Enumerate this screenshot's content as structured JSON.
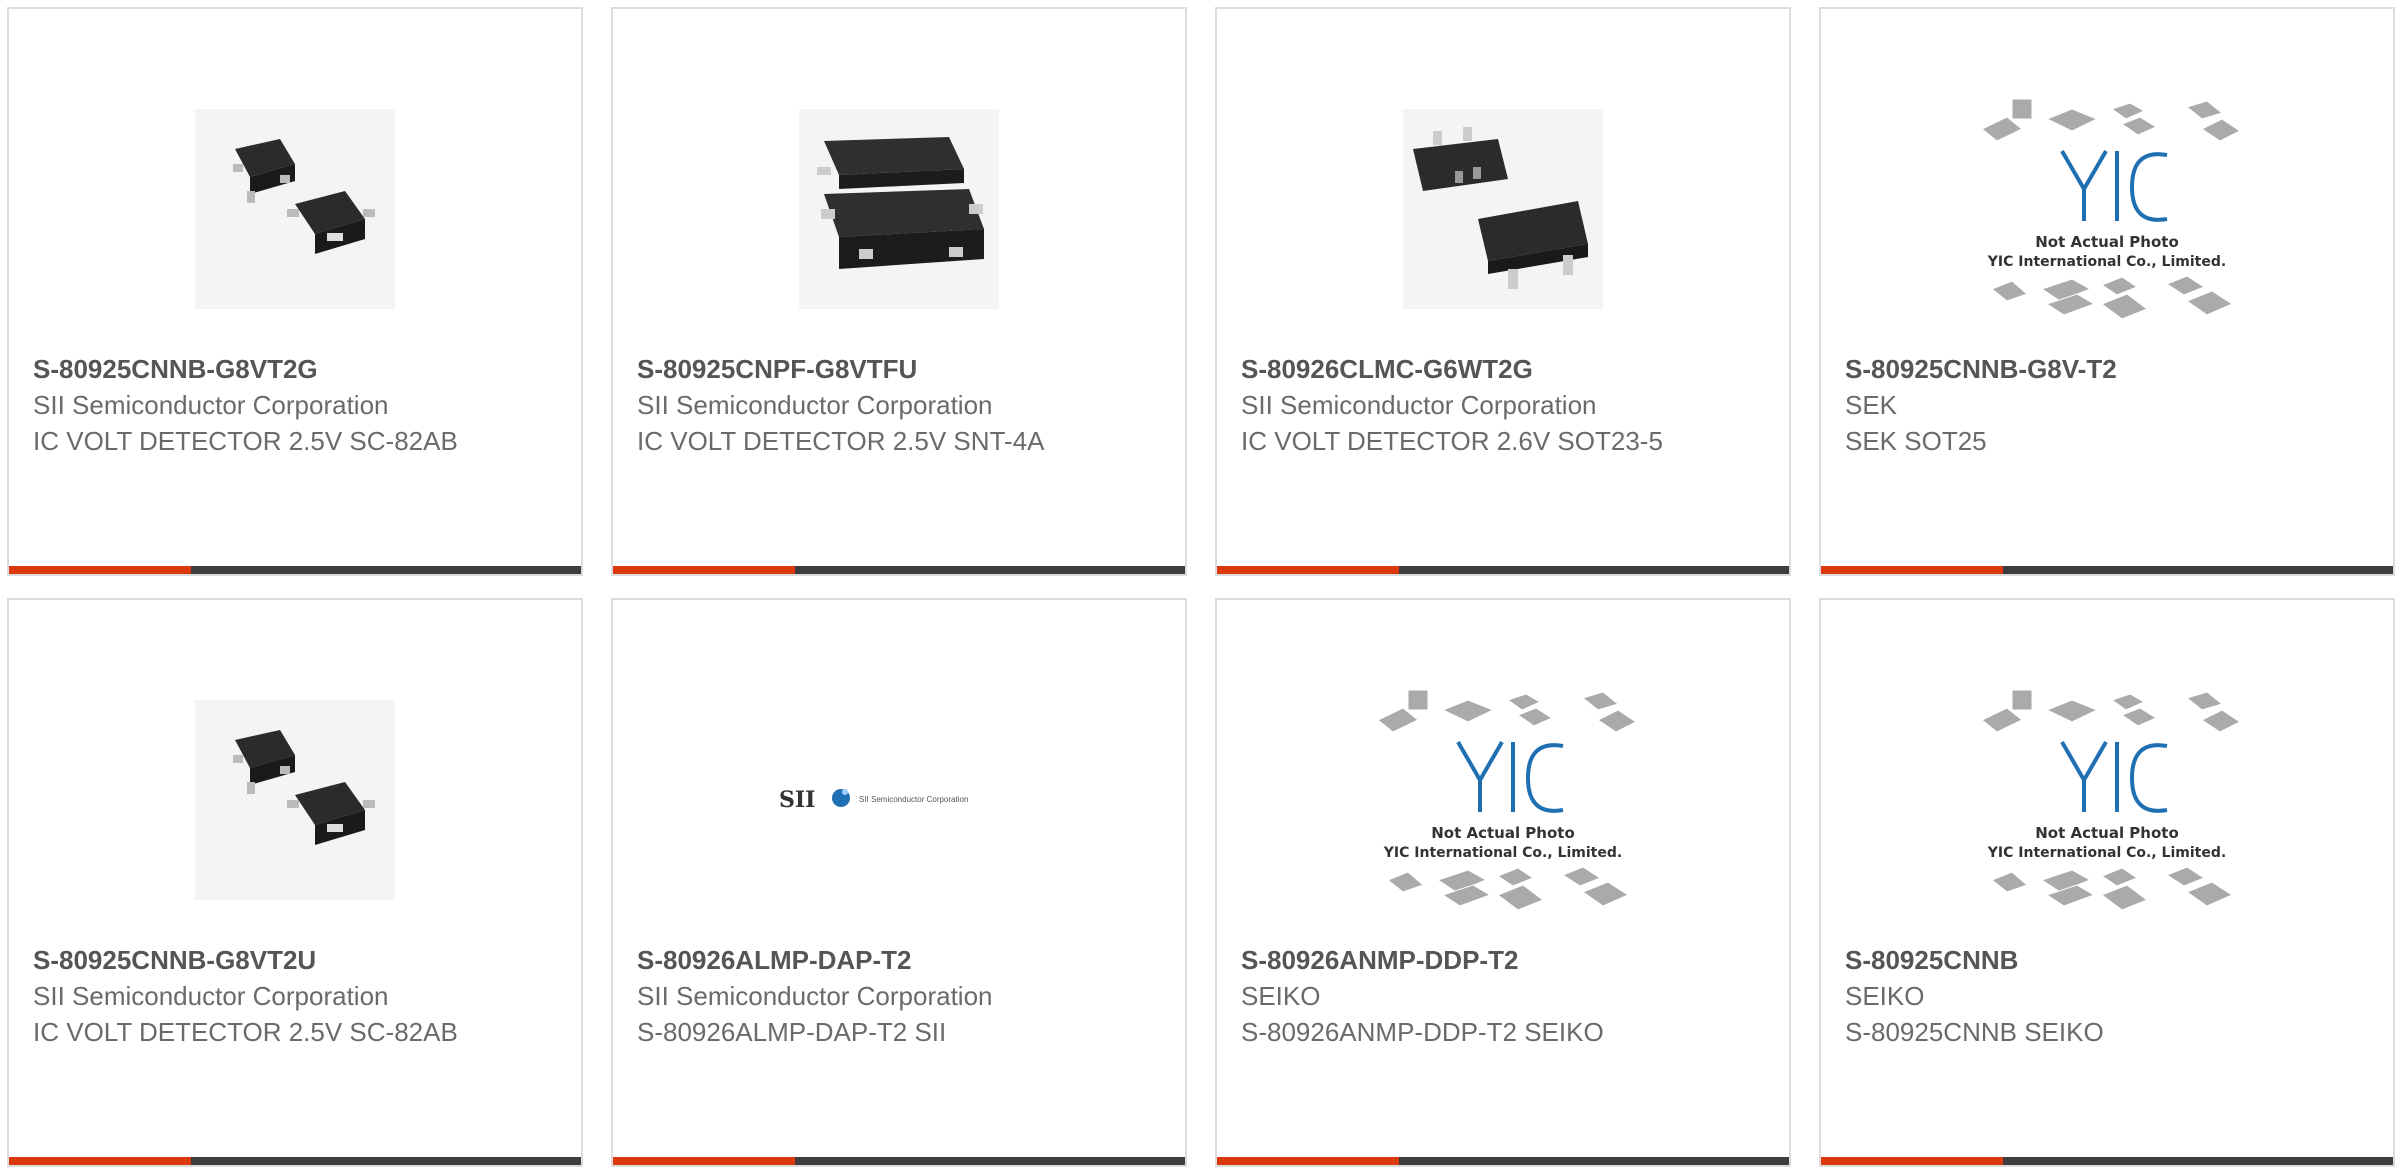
{
  "products": [
    {
      "part": "S-80925CNNB-G8VT2G",
      "maker": "SII Semiconductor Corporation",
      "desc": "IC VOLT DETECTOR 2.5V SC-82AB",
      "image": "sc82ab-chip"
    },
    {
      "part": "S-80925CNPF-G8VTFU",
      "maker": "SII Semiconductor Corporation",
      "desc": "IC VOLT DETECTOR 2.5V SNT-4A",
      "image": "snt4a-chip"
    },
    {
      "part": "S-80926CLMC-G6WT2G",
      "maker": "SII Semiconductor Corporation",
      "desc": "IC VOLT DETECTOR 2.6V SOT23-5",
      "image": "sot23-chip"
    },
    {
      "part": "S-80925CNNB-G8V-T2",
      "maker": "SEK",
      "desc": "SEK SOT25",
      "image": "yic-placeholder"
    },
    {
      "part": "S-80925CNNB-G8VT2U",
      "maker": "SII Semiconductor Corporation",
      "desc": "IC VOLT DETECTOR 2.5V SC-82AB",
      "image": "sc82ab-chip"
    },
    {
      "part": "S-80926ALMP-DAP-T2",
      "maker": "SII Semiconductor Corporation",
      "desc": "S-80926ALMP-DAP-T2 SII",
      "image": "sii-logo"
    },
    {
      "part": "S-80926ANMP-DDP-T2",
      "maker": "SEIKO",
      "desc": "S-80926ANMP-DDP-T2 SEIKO",
      "image": "yic-placeholder"
    },
    {
      "part": "S-80925CNNB",
      "maker": "SEIKO",
      "desc": "S-80925CNNB SEIKO",
      "image": "yic-placeholder"
    }
  ],
  "placeholder": {
    "line1": "Not Actual Photo",
    "line2": "YIC International Co., Limited."
  },
  "sii_logo": {
    "mark": "SII",
    "name": "SII Semiconductor Corporation"
  },
  "colors": {
    "accent": "#d9390d",
    "bar": "#3d3d3d",
    "border": "#dcdcdc",
    "text": "#6a6a6a",
    "part_text": "#555555"
  }
}
